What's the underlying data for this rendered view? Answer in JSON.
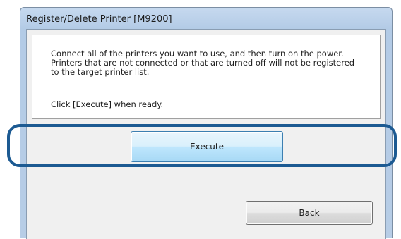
{
  "window": {
    "title": "Register/Delete Printer [M9200]"
  },
  "message": {
    "line1": "Connect all of the printers you want to use, and then turn on the power.",
    "line2": "Printers that are not connected or that are turned off will not be registered",
    "line3": "to the target printer list.",
    "line4": "Click [Execute] when ready."
  },
  "buttons": {
    "execute_label": "Execute",
    "back_label": "Back"
  },
  "colors": {
    "highlight": "#1c5a92",
    "window_frame": "#b7cde6",
    "execute_button": "#bee6fd"
  }
}
